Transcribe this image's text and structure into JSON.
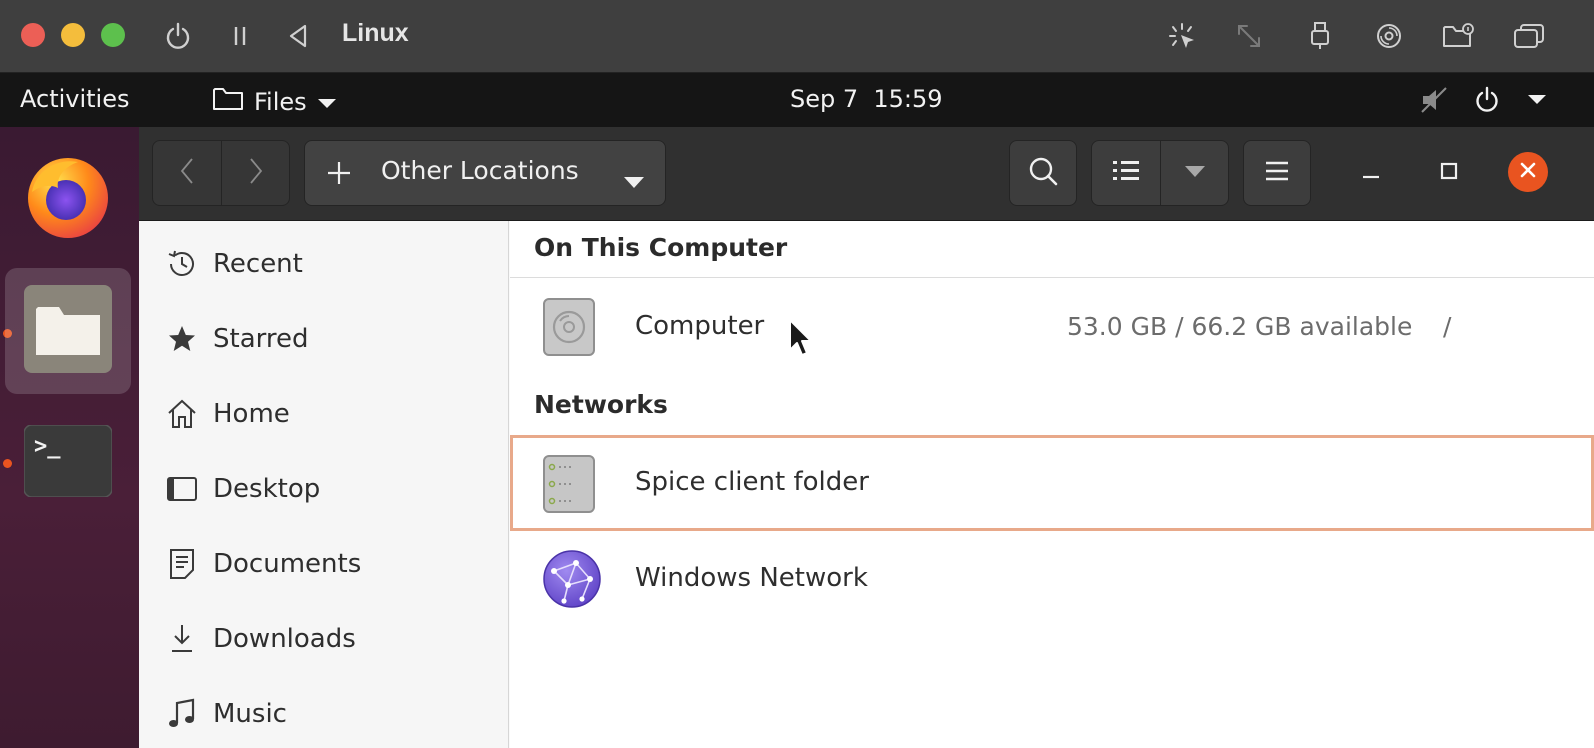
{
  "vm_bar": {
    "title": "Linux",
    "icons": [
      "power-icon",
      "pause-icon",
      "back-triangle-icon",
      "cursor-capture-icon",
      "resize-icon",
      "usb-icon",
      "disc-icon",
      "shared-folder-icon",
      "window-overlap-icon"
    ],
    "traffic_colors": {
      "close": "#ec5f56",
      "minimize": "#f4bd3c",
      "zoom": "#5dc04d"
    }
  },
  "topbar": {
    "activities": "Activities",
    "app_menu": "Files",
    "clock": "Sep 7  15:59",
    "status_icons": [
      "speaker-muted-icon",
      "power-icon",
      "chevron-down-icon"
    ]
  },
  "dock": {
    "items": [
      {
        "name": "firefox",
        "icon": "firefox-icon"
      },
      {
        "name": "files",
        "icon": "folder-icon",
        "active": true
      },
      {
        "name": "terminal",
        "icon": "terminal-icon",
        "glyph": ">_"
      }
    ],
    "accent": "#e95420"
  },
  "headerbar": {
    "location": "Other Locations",
    "icons": [
      "back-icon",
      "forward-icon",
      "plus-icon",
      "chevron-down-icon",
      "search-icon",
      "list-view-icon",
      "chevron-down-icon",
      "hamburger-menu-icon",
      "minimize-icon",
      "maximize-icon",
      "close-icon"
    ]
  },
  "sidebar": {
    "items": [
      {
        "label": "Recent",
        "icon": "clock-icon"
      },
      {
        "label": "Starred",
        "icon": "star-icon"
      },
      {
        "label": "Home",
        "icon": "home-icon"
      },
      {
        "label": "Desktop",
        "icon": "desktop-icon"
      },
      {
        "label": "Documents",
        "icon": "document-icon"
      },
      {
        "label": "Downloads",
        "icon": "download-icon"
      },
      {
        "label": "Music",
        "icon": "music-icon"
      }
    ]
  },
  "main": {
    "on_this_computer": {
      "header": "On This Computer",
      "rows": [
        {
          "name": "Computer",
          "space": "53.0 GB / 66.2 GB available",
          "mount": "/",
          "icon": "hard-drive-icon"
        }
      ]
    },
    "networks": {
      "header": "Networks",
      "rows": [
        {
          "name": "Spice client folder",
          "icon": "network-server-icon",
          "selected": true
        },
        {
          "name": "Windows Network",
          "icon": "network-globe-icon"
        }
      ]
    }
  }
}
